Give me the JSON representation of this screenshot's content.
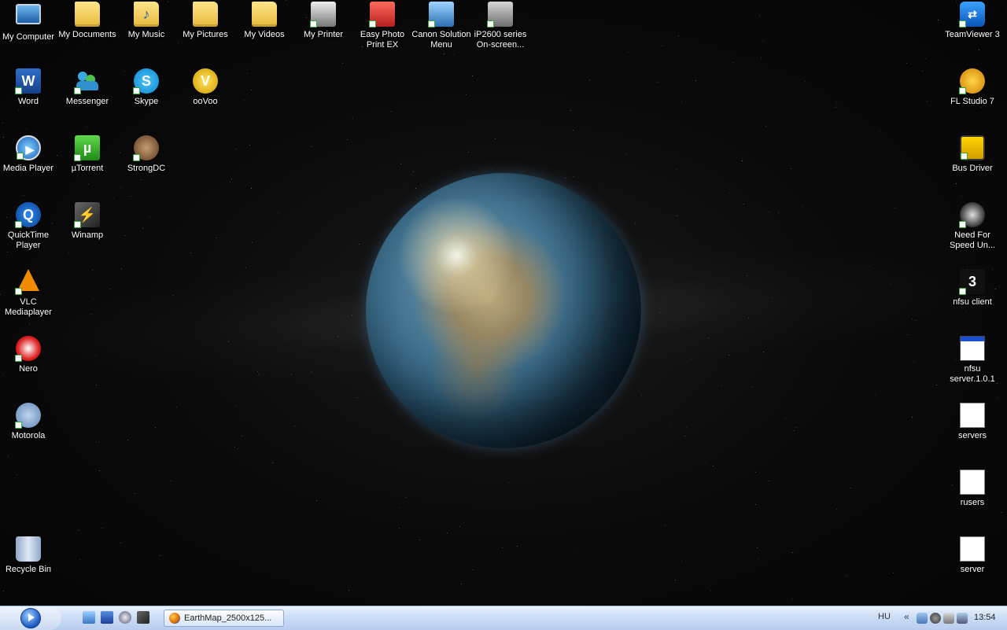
{
  "desktop_icons_left": [
    {
      "label": "My Computer",
      "icon": "my-computer-icon"
    },
    {
      "label": "My Documents",
      "icon": "my-documents-icon"
    },
    {
      "label": "My Music",
      "icon": "my-music-icon"
    },
    {
      "label": "My Pictures",
      "icon": "my-pictures-icon"
    },
    {
      "label": "My Videos",
      "icon": "my-videos-icon"
    },
    {
      "label": "My Printer",
      "icon": "printer-icon"
    },
    {
      "label": "Easy Photo Print EX",
      "icon": "easy-photo-print-icon"
    },
    {
      "label": "Canon Solution Menu",
      "icon": "canon-icon"
    },
    {
      "label": "iP2600 series On-screen...",
      "icon": "ip2600-icon"
    },
    {
      "label": "Word",
      "icon": "word-icon"
    },
    {
      "label": "Messenger",
      "icon": "messenger-icon"
    },
    {
      "label": "Skype",
      "icon": "skype-icon"
    },
    {
      "label": "ooVoo",
      "icon": "oovoo-icon"
    },
    {
      "label": "Media Player",
      "icon": "media-player-icon"
    },
    {
      "label": "µTorrent",
      "icon": "utorrent-icon"
    },
    {
      "label": "StrongDC",
      "icon": "strongdc-icon"
    },
    {
      "label": "QuickTime Player",
      "icon": "quicktime-icon"
    },
    {
      "label": "Winamp",
      "icon": "winamp-icon"
    },
    {
      "label": "VLC Mediaplayer",
      "icon": "vlc-icon"
    },
    {
      "label": "Nero",
      "icon": "nero-icon"
    },
    {
      "label": "Motorola",
      "icon": "motorola-icon"
    },
    {
      "label": "Recycle Bin",
      "icon": "recycle-bin-icon"
    }
  ],
  "desktop_icons_right": [
    {
      "label": "TeamViewer 3",
      "icon": "teamviewer-icon"
    },
    {
      "label": "FL Studio 7",
      "icon": "fl-studio-icon"
    },
    {
      "label": "Bus Driver",
      "icon": "bus-driver-icon"
    },
    {
      "label": "Need For Speed Un...",
      "icon": "need-for-speed-icon"
    },
    {
      "label": "nfsu client",
      "icon": "nfsu-client-icon"
    },
    {
      "label": "nfsu server.1.0.1",
      "icon": "application-window-icon"
    },
    {
      "label": "servers",
      "icon": "settings-file-icon"
    },
    {
      "label": "rusers",
      "icon": "settings-file-icon"
    },
    {
      "label": "server",
      "icon": "text-file-icon"
    }
  ],
  "taskbar": {
    "task_button_label": "EarthMap_2500x125...",
    "language": "HU",
    "clock": "13:54"
  }
}
